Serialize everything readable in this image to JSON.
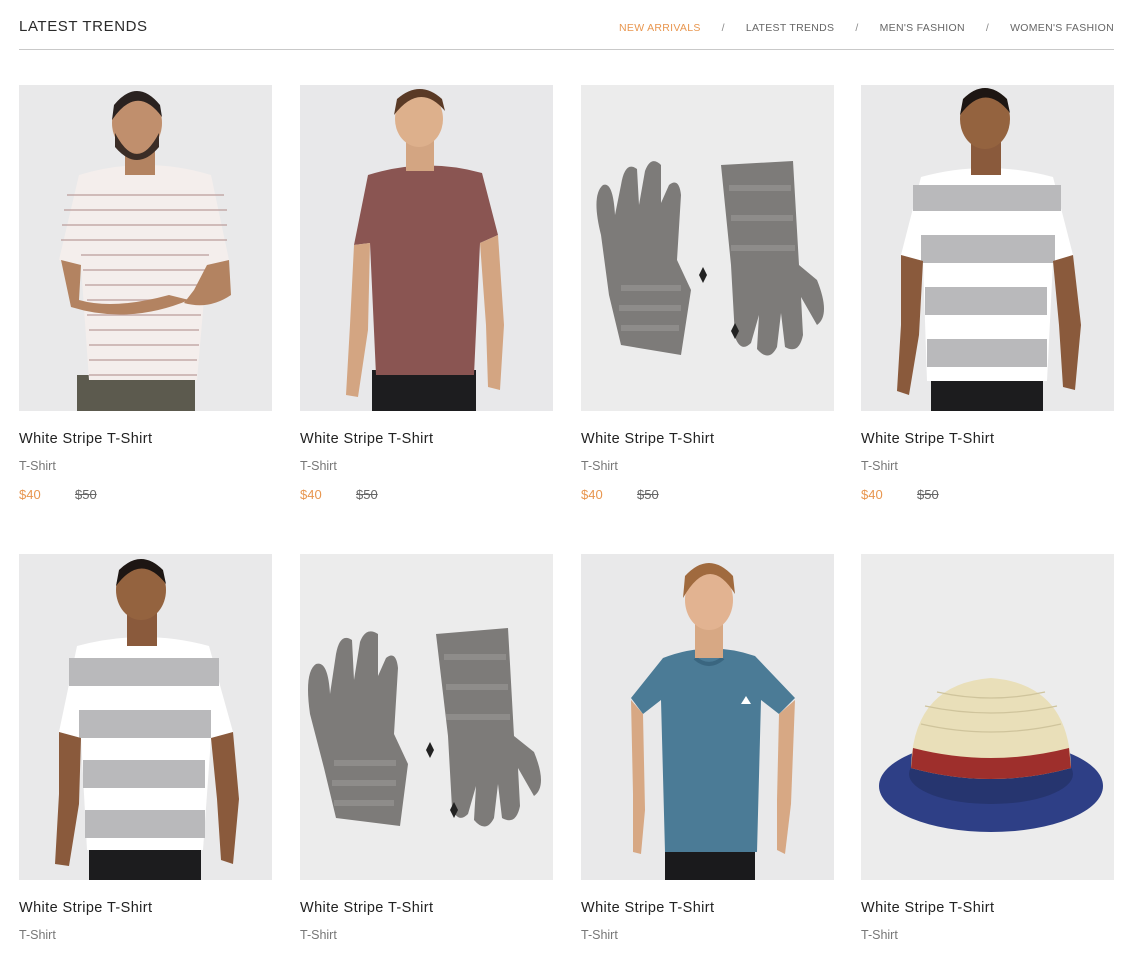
{
  "header": {
    "title": "LATEST TRENDS",
    "filters": [
      "NEW ARRIVALS",
      "LATEST TRENDS",
      "MEN'S FASHION",
      "WOMEN'S FASHION"
    ],
    "active_filter": "NEW ARRIVALS",
    "separator": "/"
  },
  "colors": {
    "accent": "#e8964f",
    "text": "#222222",
    "muted": "#777777",
    "divider": "#c9c9c9"
  },
  "products": [
    {
      "name": "White Stripe T-Shirt",
      "category": "T-Shirt",
      "price": "$40",
      "old_price": "$50",
      "image": "man-thin-striped-tee"
    },
    {
      "name": "White Stripe T-Shirt",
      "category": "T-Shirt",
      "price": "$40",
      "old_price": "$50",
      "image": "man-maroon-tee"
    },
    {
      "name": "White Stripe T-Shirt",
      "category": "T-Shirt",
      "price": "$40",
      "old_price": "$50",
      "image": "grey-knit-gloves"
    },
    {
      "name": "White Stripe T-Shirt",
      "category": "T-Shirt",
      "price": "$40",
      "old_price": "$50",
      "image": "man-wide-striped-tee"
    },
    {
      "name": "White Stripe T-Shirt",
      "category": "T-Shirt",
      "image": "man-wide-striped-tee"
    },
    {
      "name": "White Stripe T-Shirt",
      "category": "T-Shirt",
      "image": "grey-knit-gloves"
    },
    {
      "name": "White Stripe T-Shirt",
      "category": "T-Shirt",
      "image": "man-blue-tee"
    },
    {
      "name": "White Stripe T-Shirt",
      "category": "T-Shirt",
      "image": "straw-fedora-hat"
    }
  ]
}
